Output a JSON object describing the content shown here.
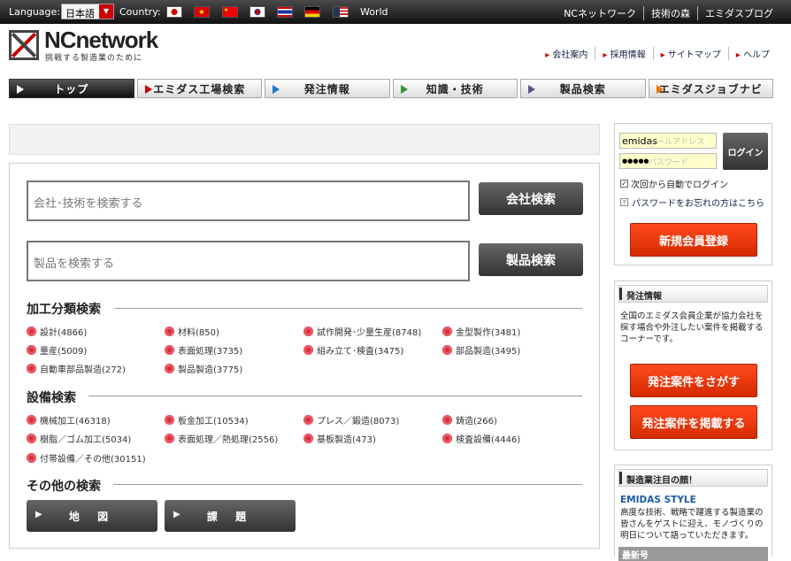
{
  "topbar": {
    "language_label": "Language:",
    "language_value": "日本語",
    "country_label": "Country:",
    "world": "World",
    "links": [
      "NCネットワーク",
      "技術の森",
      "エミダスブログ"
    ]
  },
  "logo": {
    "name": "NCnetwork",
    "tagline": "挑戦する製造業のために"
  },
  "header_links": [
    "会社案内",
    "採用情報",
    "サイトマップ",
    "ヘルプ"
  ],
  "nav": [
    "トップ",
    "エミダス工場検索",
    "発注情報",
    "知識・技術",
    "製品検索",
    "エミダスジョブナビ"
  ],
  "search": {
    "company_placeholder": "会社･技術を検索する",
    "company_button": "会社検索",
    "product_placeholder": "製品を検索する",
    "product_button": "製品検索"
  },
  "section1": {
    "title": "加工分類検索",
    "items": [
      "設計(4866)",
      "材料(850)",
      "試作開発･少量生産(8748)",
      "金型製作(3481)",
      "量産(5009)",
      "表面処理(3735)",
      "組み立て･検査(3475)",
      "部品製造(3495)",
      "自動車部品製造(272)",
      "製品製造(3775)"
    ]
  },
  "section2": {
    "title": "設備検索",
    "items": [
      "機械加工(46318)",
      "板金加工(10534)",
      "プレス／鍛造(8073)",
      "鋳造(266)",
      "樹脂／ゴム加工(5034)",
      "表面処理／熱処理(2556)",
      "基板製造(473)",
      "検査設備(4446)",
      "付帯設備／その他(30151)"
    ]
  },
  "section3": {
    "title": "その他の検索",
    "buttons": [
      "地 図",
      "課 題"
    ]
  },
  "login": {
    "email_value": "emidas",
    "email_placeholder": "メールアドレス",
    "password_value": "●●●●●",
    "password_placeholder": "パスワード",
    "login_button": "ログイン",
    "auto_login": "次回から自動でログイン",
    "forgot": "パスワードをお忘れの方はこちら",
    "register": "新規会員登録"
  },
  "order": {
    "heading": "発注情報",
    "text": "全国のエミダス会員企業が協力会社を探す場合や外注したい案件を掲載するコーナーです。",
    "find": "発注案件をさがす",
    "post": "発注案件を掲載する"
  },
  "feature": {
    "heading": "製造業注目の顔！",
    "title": "EMIDAS STYLE",
    "text": "高度な技術、戦略で躍進する製造業の皆さんをゲストに迎え、モノづくりの明日について語っていただきます。",
    "issue": "最新号"
  }
}
